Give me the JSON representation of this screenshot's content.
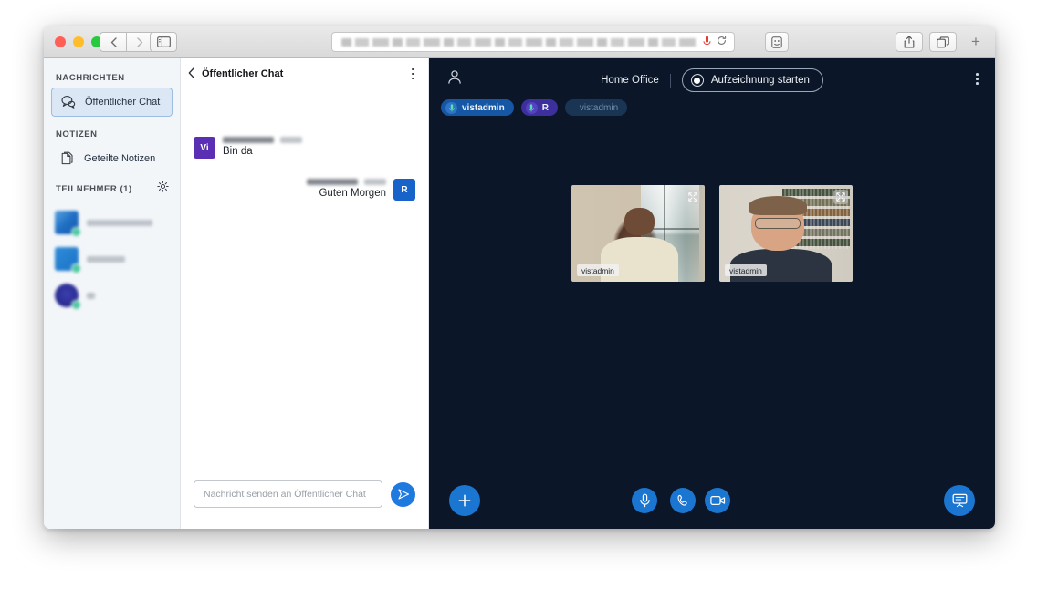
{
  "browser": {
    "name": "safari",
    "url_redacted": true,
    "back_label": "Back",
    "forward_label": "Forward",
    "sidebar_toggle_label": "Sidebar",
    "reader_label": "Reader",
    "share_label": "Share",
    "tab_overview_label": "Tab Overview",
    "new_tab_label": "+",
    "mic_indicator_label": "Microphone in use",
    "reload_label": "Reload"
  },
  "sidebar": {
    "sections": [
      {
        "title": "NACHRICHTEN"
      },
      {
        "title": "NOTIZEN"
      }
    ],
    "messages_item": {
      "label": "Öffentlicher Chat",
      "icon": "chat-bubble-icon",
      "active": true
    },
    "notes_item": {
      "label": "Geteilte Notizen",
      "icon": "notes-icon",
      "active": false
    },
    "participants": {
      "title": "TEILNEHMER (1)",
      "count": 1,
      "settings_icon": "gear-icon",
      "items": [
        {
          "name_redacted": true,
          "avatar": "blue-square",
          "status": "online"
        },
        {
          "name_redacted": true,
          "avatar": "blue-square",
          "status": "online"
        },
        {
          "name_redacted": true,
          "avatar": "navy-circle",
          "status": "online"
        }
      ]
    }
  },
  "chat": {
    "header": {
      "title": "Öffentlicher Chat",
      "back_icon": "chevron-left-icon",
      "menu_icon": "kebab-menu-icon"
    },
    "messages": [
      {
        "initials": "Vi",
        "avatar_color": "#5b2fb3",
        "author_redacted": true,
        "time_redacted": true,
        "text": "Bin da",
        "own": false
      },
      {
        "initials": "R",
        "avatar_color": "#1763c9",
        "author_redacted": true,
        "time_redacted": true,
        "text": "Guten Morgen",
        "own": true
      }
    ],
    "composer": {
      "placeholder": "Nachricht senden an Öffentlicher Chat",
      "value": "",
      "send_icon": "send-paper-plane-icon",
      "send_label": "Senden"
    }
  },
  "stage": {
    "background": "#0b1729",
    "accent": "#1b76d2",
    "user_icon": "person-icon",
    "room_name": "Home Office",
    "record_button": {
      "label": "Aufzeichnung starten",
      "icon": "record-circle-icon"
    },
    "menu_icon": "kebab-menu-icon",
    "pills": [
      {
        "label": "vistadmin",
        "icon": "microphone-icon",
        "style": "blue"
      },
      {
        "label": "R",
        "icon": "microphone-icon",
        "style": "purple"
      },
      {
        "label": "vistadmin",
        "icon": "microphone-muted-icon",
        "style": "ghost"
      }
    ],
    "tiles": [
      {
        "name": "vistadmin",
        "expand_icon": "expand-arrows-icon"
      },
      {
        "name": "vistadmin",
        "expand_icon": "expand-arrows-icon"
      }
    ],
    "toolbar": [
      {
        "name": "add",
        "icon": "plus-icon",
        "label": "Hinzufügen"
      },
      {
        "name": "microphone",
        "icon": "microphone-icon",
        "label": "Mikrofon"
      },
      {
        "name": "audio",
        "icon": "phone-icon",
        "label": "Audio"
      },
      {
        "name": "camera",
        "icon": "video-camera-icon",
        "label": "Webcam"
      },
      {
        "name": "present",
        "icon": "presentation-screen-icon",
        "label": "Bildschirm freigeben"
      }
    ]
  }
}
